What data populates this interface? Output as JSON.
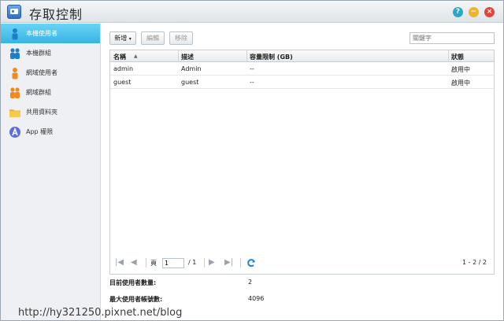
{
  "window": {
    "title": "存取控制",
    "help_label": "?",
    "minimize_label": "−",
    "close_label": "×"
  },
  "sidebar": {
    "items": [
      {
        "label": "本機使用者",
        "icon": "user-icon",
        "active": true
      },
      {
        "label": "本機群組",
        "icon": "group-icon",
        "active": false
      },
      {
        "label": "網域使用者",
        "icon": "domain-user-icon",
        "active": false
      },
      {
        "label": "網域群組",
        "icon": "domain-group-icon",
        "active": false
      },
      {
        "label": "共用資料夾",
        "icon": "folder-icon",
        "active": false
      },
      {
        "label": "App 權限",
        "icon": "app-icon",
        "active": false
      }
    ]
  },
  "toolbar": {
    "add_label": "新增",
    "edit_label": "編輯",
    "remove_label": "移除",
    "search_placeholder": "關鍵字"
  },
  "table": {
    "headers": {
      "name": "名稱",
      "desc": "描述",
      "quota": "容量限制 (GB)",
      "status": "狀態"
    },
    "rows": [
      {
        "name": "admin",
        "desc": "Admin",
        "quota": "--",
        "status": "啟用中"
      },
      {
        "name": "guest",
        "desc": "guest",
        "quota": "--",
        "status": "啟用中"
      }
    ]
  },
  "pager": {
    "page_label": "頁",
    "page_value": "1",
    "total": "/ 1",
    "range": "1 - 2 / 2"
  },
  "stats": {
    "current_users_label": "目前使用者數量:",
    "current_users_value": "2",
    "max_users_label": "最大使用者帳號數:",
    "max_users_value": "4096"
  },
  "watermark": "http://hy321250.pixnet.net/blog",
  "colors": {
    "accent": "#38b4e2",
    "help": "#2aa7c9",
    "minimize": "#f0b429",
    "close": "#e0463a"
  }
}
